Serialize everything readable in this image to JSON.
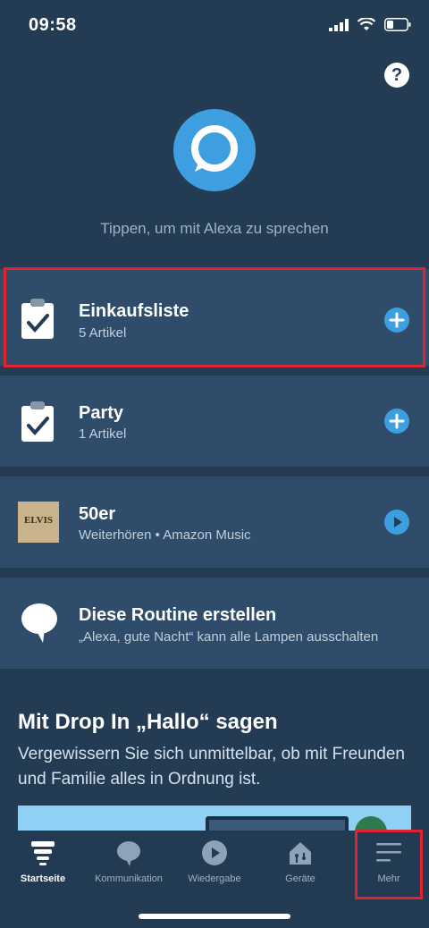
{
  "status": {
    "time": "09:58"
  },
  "help": {
    "label": "?"
  },
  "alexa": {
    "hint": "Tippen, um mit Alexa zu sprechen"
  },
  "cards": [
    {
      "title": "Einkaufsliste",
      "subtitle": "5 Artikel",
      "icon": "clipboard-check-icon",
      "action": "add-icon"
    },
    {
      "title": "Party",
      "subtitle": "1 Artikel",
      "icon": "clipboard-check-icon",
      "action": "add-icon"
    },
    {
      "title": "50er",
      "subtitle": "Weiterhören • Amazon Music",
      "icon": "album-cover",
      "cover_text": "ELVIS",
      "action": "play-icon"
    },
    {
      "title": "Diese Routine erstellen",
      "subtitle": "„Alexa, gute Nacht“ kann alle Lampen ausschalten",
      "icon": "speech-bubble-icon"
    }
  ],
  "dropin": {
    "title": "Mit Drop In „Hallo“ sagen",
    "text": "Vergewissern Sie sich unmittelbar, ob mit Freunden und Familie alles in Ordnung ist."
  },
  "tabs": [
    {
      "label": "Startseite",
      "icon": "home-icon",
      "active": true
    },
    {
      "label": "Kommunikation",
      "icon": "chat-icon",
      "active": false
    },
    {
      "label": "Wiedergabe",
      "icon": "play-icon",
      "active": false
    },
    {
      "label": "Geräte",
      "icon": "devices-icon",
      "active": false
    },
    {
      "label": "Mehr",
      "icon": "menu-icon",
      "active": false
    }
  ],
  "colors": {
    "background": "#243b54",
    "card": "#2f4c6b",
    "accent": "#3e9fe0",
    "highlight": "#e0232f"
  }
}
